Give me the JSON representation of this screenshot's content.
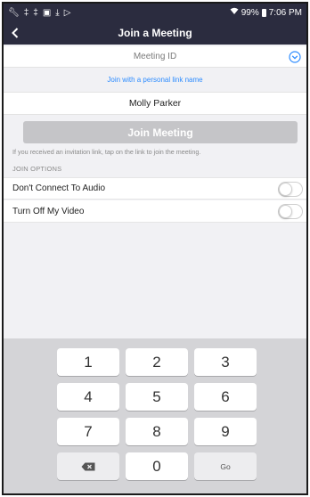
{
  "status_bar": {
    "icons_left": [
      "wrench-icon",
      "usb-icon",
      "usb-icon",
      "image-icon",
      "download-icon",
      "play-store-icon"
    ],
    "battery": "99%",
    "time": "7:06 PM"
  },
  "header": {
    "title": "Join a Meeting",
    "back_icon": "chevron-left-icon"
  },
  "form": {
    "meeting_id_placeholder": "Meeting ID",
    "personal_link_label": "Join with a personal link name",
    "name_value": "Molly Parker",
    "join_button_label": "Join Meeting",
    "hint_text": "If you received an invitation link, tap on the link to join the meeting."
  },
  "options": {
    "header": "JOIN OPTIONS",
    "items": [
      {
        "label": "Don't Connect To Audio",
        "enabled": false
      },
      {
        "label": "Turn Off My Video",
        "enabled": false
      }
    ]
  },
  "keypad": {
    "keys": [
      "1",
      "2",
      "3",
      "4",
      "5",
      "6",
      "7",
      "8",
      "9",
      "",
      "0",
      "Go"
    ],
    "delete_icon": "backspace-icon"
  },
  "colors": {
    "nav_bar": "#2b2c3f",
    "link_blue": "#2d8cff",
    "disabled_button": "#c5c5c8",
    "keypad_background": "#d4d4d7"
  }
}
